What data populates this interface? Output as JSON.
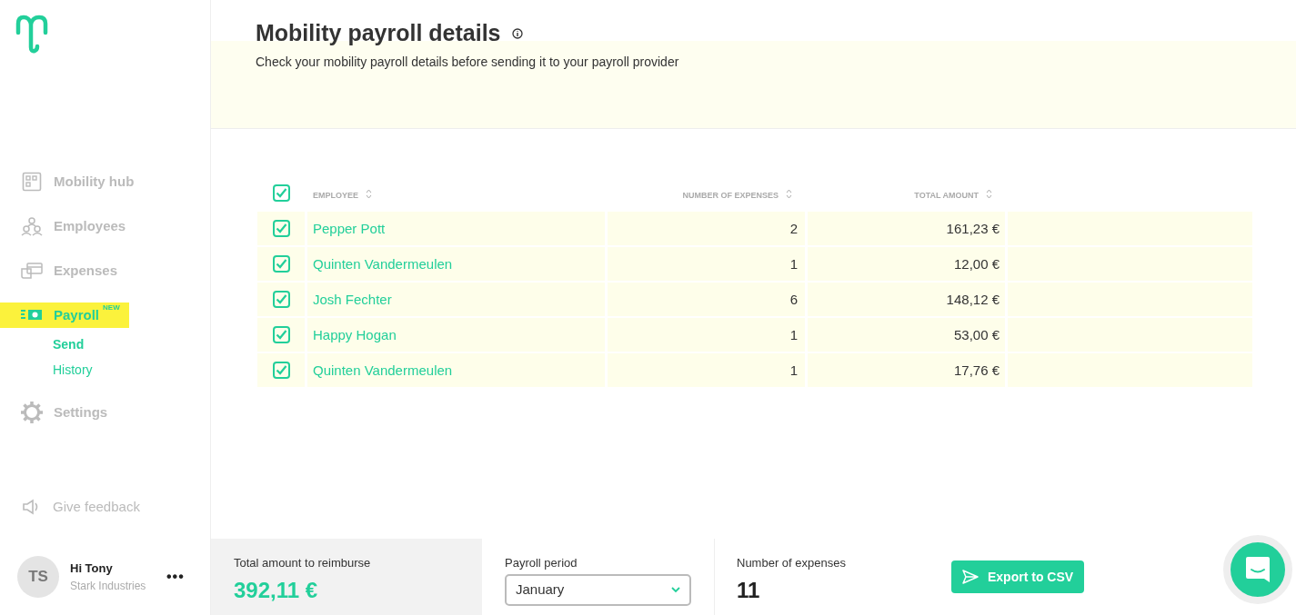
{
  "sidebar": {
    "items": [
      {
        "kind": "hub",
        "label": "Mobility hub",
        "selected": false
      },
      {
        "kind": "people",
        "label": "Employees",
        "selected": false
      },
      {
        "kind": "cards",
        "label": "Expenses",
        "selected": false
      },
      {
        "kind": "payroll",
        "label": "Payroll",
        "badge": "NEW",
        "selected": true,
        "children": [
          {
            "label": "Send",
            "selected": true
          },
          {
            "label": "History",
            "selected": false
          }
        ]
      },
      {
        "kind": "gear",
        "label": "Settings",
        "selected": false
      }
    ],
    "feedback": "Give feedback",
    "user": {
      "initials": "TS",
      "greeting": "Hi Tony",
      "company": "Stark Industries",
      "menu": "•••"
    }
  },
  "header": {
    "title": "Mobility payroll details",
    "subtitle": "Check your mobility payroll details before sending it to your payroll provider"
  },
  "table": {
    "select_all": {
      "checked": true
    },
    "columns": [
      "EMPLOYEE",
      "NUMBER OF EXPENSES",
      "TOTAL AMOUNT"
    ],
    "rows": [
      {
        "checked": true,
        "employee": "Pepper Pott",
        "expenses": "2",
        "amount": "161,23 €"
      },
      {
        "checked": true,
        "employee": "Quinten Vandermeulen",
        "expenses": "1",
        "amount": "12,00 €"
      },
      {
        "checked": true,
        "employee": "Josh Fechter",
        "expenses": "6",
        "amount": "148,12 €"
      },
      {
        "checked": true,
        "employee": "Happy Hogan",
        "expenses": "1",
        "amount": "53,00 €"
      },
      {
        "checked": true,
        "employee": "Quinten Vandermeulen",
        "expenses": "1",
        "amount": "17,76 €"
      }
    ]
  },
  "footer": {
    "total_label": "Total amount to reimburse",
    "total": "392,11 €",
    "period_label": "Payroll period",
    "period": "January",
    "count_label": "Number of expenses",
    "count": "11",
    "export": "Export to CSV"
  }
}
